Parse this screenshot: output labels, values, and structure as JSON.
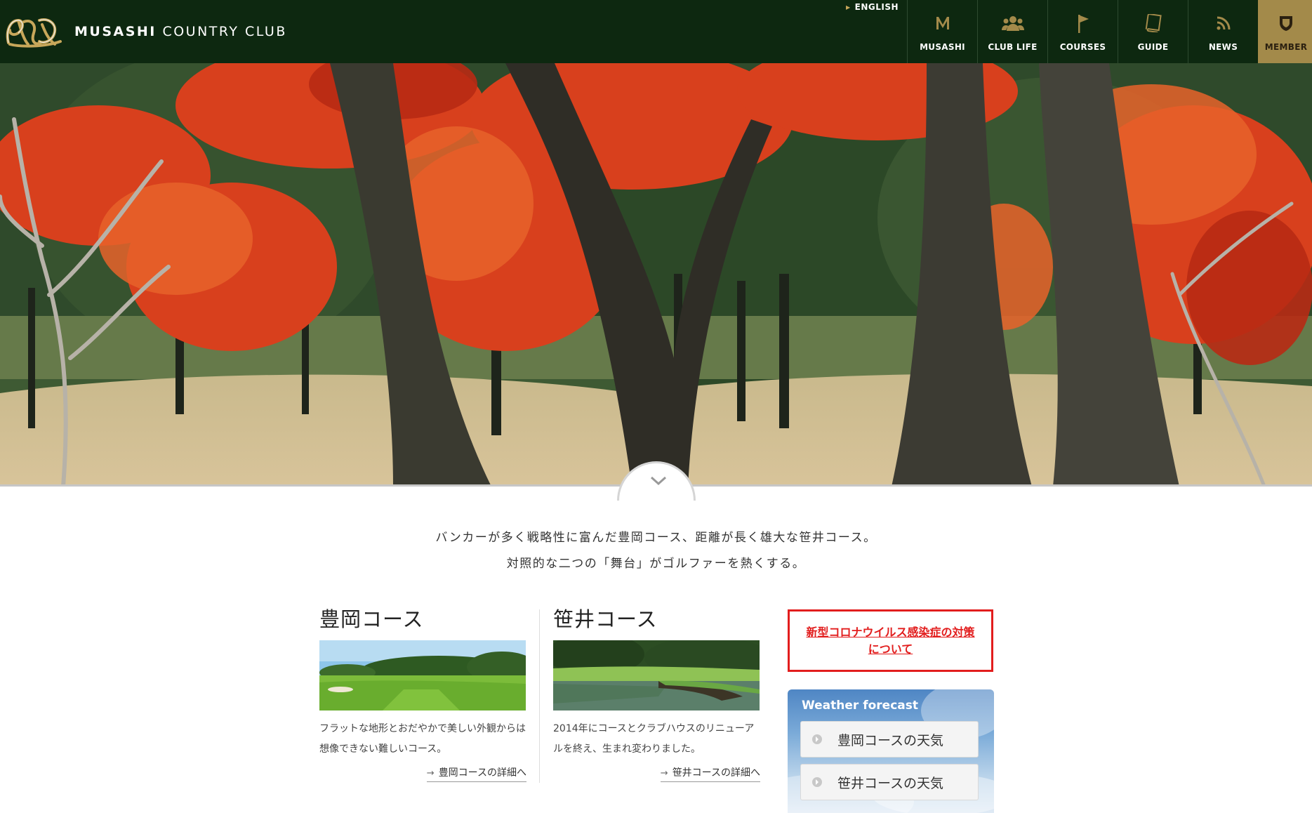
{
  "header": {
    "brand_bold": "MUSASHI",
    "brand_light": "COUNTRY CLUB",
    "english_link": "ENGLISH",
    "bg_color": "#0d2810",
    "accent_color": "#a38a4a",
    "nav": [
      {
        "label": "MUSASHI",
        "icon": "m-letter-icon"
      },
      {
        "label": "CLUB LIFE",
        "icon": "people-icon"
      },
      {
        "label": "COURSES",
        "icon": "flag-icon"
      },
      {
        "label": "GUIDE",
        "icon": "book-icon"
      },
      {
        "label": "NEWS",
        "icon": "rss-icon"
      },
      {
        "label": "MEMBER",
        "icon": "shield-icon"
      }
    ]
  },
  "intro": {
    "line1": "バンカーが多く戦略性に富んだ豊岡コース、距離が長く雄大な笹井コース。",
    "line2": "対照的な二つの「舞台」がゴルファーを熱くする。"
  },
  "courses": [
    {
      "title": "豊岡コース",
      "desc": "フラットな地形とおだやかで美しい外観からは想像できない難しいコース。",
      "link": "豊岡コースの詳細へ"
    },
    {
      "title": "笹井コース",
      "desc": "2014年にコースとクラブハウスのリニューアルを終え、生まれ変わりました。",
      "link": "笹井コースの詳細へ"
    }
  ],
  "notice": {
    "text": "新型コロナウイルス感染症の対策について",
    "color": "#e21d1d"
  },
  "weather": {
    "title": "Weather forecast",
    "buttons": [
      "豊岡コースの天気",
      "笹井コースの天気"
    ]
  }
}
